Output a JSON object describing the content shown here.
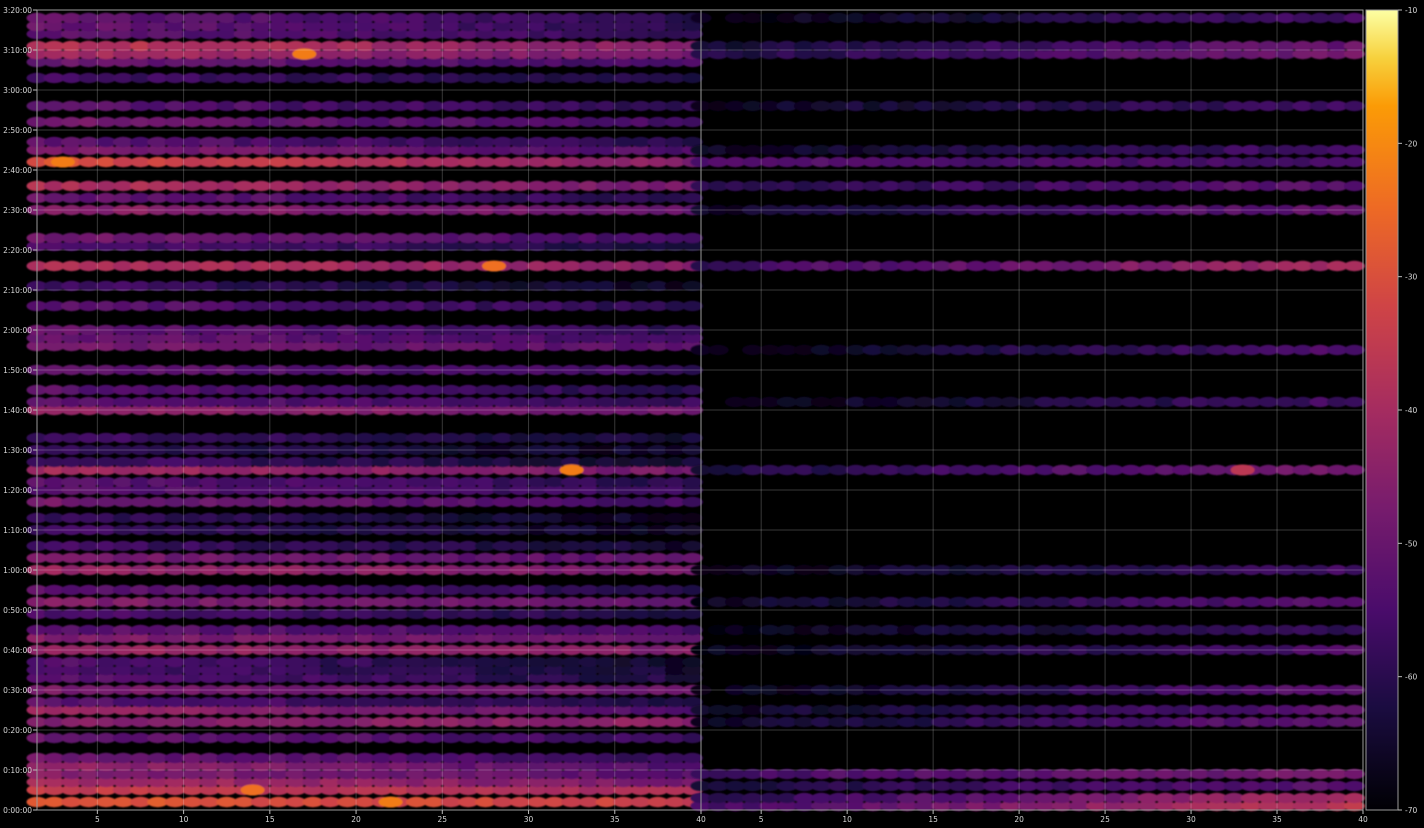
{
  "chart_data": {
    "type": "heatmap",
    "panels": [
      {
        "name": "",
        "x_ticks": [
          "5",
          "10",
          "15",
          "20",
          "25",
          "30",
          "35",
          "40"
        ],
        "x_tick_values": [
          5,
          10,
          15,
          20,
          25,
          30,
          35,
          40
        ],
        "xlim": [
          1.5,
          40
        ]
      },
      {
        "name": "",
        "x_ticks": [
          "5",
          "10",
          "15",
          "20",
          "25",
          "30",
          "35",
          "40"
        ],
        "x_tick_values": [
          5,
          10,
          15,
          20,
          25,
          30,
          35,
          40
        ],
        "xlim": [
          1.5,
          40
        ]
      }
    ],
    "y_ticks": [
      "0:00:00",
      "0:10:00",
      "0:20:00",
      "0:30:00",
      "0:40:00",
      "0:50:00",
      "1:00:00",
      "1:10:00",
      "1:20:00",
      "1:30:00",
      "1:40:00",
      "1:50:00",
      "2:00:00",
      "2:10:00",
      "2:20:00",
      "2:30:00",
      "2:40:00",
      "2:50:00",
      "3:00:00",
      "3:10:00",
      "3:20:00"
    ],
    "y_tick_minutes": [
      0,
      10,
      20,
      30,
      40,
      50,
      60,
      70,
      80,
      90,
      100,
      110,
      120,
      130,
      140,
      150,
      160,
      170,
      180,
      190,
      200
    ],
    "ylim_minutes": [
      0,
      200
    ],
    "x_range": [
      1.5,
      39.5
    ],
    "grid": true,
    "colorbar": {
      "ticks": [
        "-10",
        "-20",
        "-30",
        "-40",
        "-50",
        "-60",
        "-70"
      ],
      "tick_values": [
        -10,
        -20,
        -30,
        -40,
        -50,
        -60,
        -70
      ],
      "range": [
        -70,
        -10
      ],
      "colormap": "inferno"
    },
    "bands": [
      {
        "t": 2,
        "l": -28,
        "r": -34
      },
      {
        "t": 5,
        "l": -34,
        "r": -40
      },
      {
        "t": 7,
        "l": -40,
        "r": -47
      },
      {
        "t": 9,
        "l": -45,
        "r": -52
      },
      {
        "t": 11,
        "l": -43,
        "r": -54
      },
      {
        "t": 13,
        "l": -49,
        "r": -58
      },
      {
        "t": 18,
        "l": -50,
        "r": -58
      },
      {
        "t": 22,
        "l": -46,
        "r": -44
      },
      {
        "t": 25,
        "l": -40,
        "r": -54
      },
      {
        "t": 27,
        "l": -52,
        "r": -62
      },
      {
        "t": 30,
        "l": -47,
        "r": -50
      },
      {
        "t": 33,
        "l": -52,
        "r": -62
      },
      {
        "t": 35,
        "l": -54,
        "r": -64
      },
      {
        "t": 37,
        "l": -54,
        "r": -64
      },
      {
        "t": 40,
        "l": -42,
        "r": -46
      },
      {
        "t": 43,
        "l": -46,
        "r": -50
      },
      {
        "t": 45,
        "l": -52,
        "r": -56
      },
      {
        "t": 49,
        "l": -54,
        "r": -62
      },
      {
        "t": 52,
        "l": -46,
        "r": -50
      },
      {
        "t": 55,
        "l": -52,
        "r": -60
      },
      {
        "t": 60,
        "l": -42,
        "r": -48
      },
      {
        "t": 63,
        "l": -48,
        "r": -52
      },
      {
        "t": 66,
        "l": -56,
        "r": -64
      },
      {
        "t": 70,
        "l": -56,
        "r": -66
      },
      {
        "t": 73,
        "l": -58,
        "r": -66
      },
      {
        "t": 77,
        "l": -48,
        "r": -56
      },
      {
        "t": 80,
        "l": -52,
        "r": -58
      },
      {
        "t": 82,
        "l": -52,
        "r": -60
      },
      {
        "t": 85,
        "l": -40,
        "r": -48
      },
      {
        "t": 87,
        "l": -56,
        "r": -64
      },
      {
        "t": 90,
        "l": -58,
        "r": -66
      },
      {
        "t": 93,
        "l": -56,
        "r": -64
      },
      {
        "t": 100,
        "l": -42,
        "r": -50
      },
      {
        "t": 102,
        "l": -52,
        "r": -58
      },
      {
        "t": 105,
        "l": -52,
        "r": -60
      },
      {
        "t": 110,
        "l": -50,
        "r": -58
      },
      {
        "t": 116,
        "l": -48,
        "r": -52
      },
      {
        "t": 118,
        "l": -50,
        "r": -56
      },
      {
        "t": 120,
        "l": -50,
        "r": -60
      },
      {
        "t": 126,
        "l": -52,
        "r": -60
      },
      {
        "t": 131,
        "l": -56,
        "r": -66
      },
      {
        "t": 136,
        "l": -38,
        "r": -44
      },
      {
        "t": 141,
        "l": -54,
        "r": -62
      },
      {
        "t": 143,
        "l": -48,
        "r": -56
      },
      {
        "t": 150,
        "l": -44,
        "r": -50
      },
      {
        "t": 153,
        "l": -50,
        "r": -60
      },
      {
        "t": 156,
        "l": -38,
        "r": -48
      },
      {
        "t": 162,
        "l": -30,
        "r": -46
      },
      {
        "t": 165,
        "l": -46,
        "r": -54
      },
      {
        "t": 167,
        "l": -52,
        "r": -60
      },
      {
        "t": 172,
        "l": -48,
        "r": -56
      },
      {
        "t": 176,
        "l": -52,
        "r": -60
      },
      {
        "t": 183,
        "l": -56,
        "r": -62
      },
      {
        "t": 187,
        "l": -50,
        "r": -56
      },
      {
        "t": 189,
        "l": -40,
        "r": -48
      },
      {
        "t": 191,
        "l": -36,
        "r": -46
      },
      {
        "t": 194,
        "l": -52,
        "r": -58
      },
      {
        "t": 196,
        "l": -50,
        "r": -60
      },
      {
        "t": 198,
        "l": -50,
        "r": -60
      }
    ],
    "bands_panel2": [
      {
        "t": 1,
        "l": -56,
        "r": -36
      },
      {
        "t": 3,
        "l": -60,
        "r": -40
      },
      {
        "t": 6,
        "l": -62,
        "r": -52
      },
      {
        "t": 9,
        "l": -56,
        "r": -48
      },
      {
        "t": 22,
        "l": -66,
        "r": -50
      },
      {
        "t": 25,
        "l": -66,
        "r": -52
      },
      {
        "t": 30,
        "l": -68,
        "r": -52
      },
      {
        "t": 40,
        "l": -68,
        "r": -54
      },
      {
        "t": 45,
        "l": -68,
        "r": -58
      },
      {
        "t": 52,
        "l": -66,
        "r": -52
      },
      {
        "t": 60,
        "l": -68,
        "r": -56
      },
      {
        "t": 85,
        "l": -62,
        "r": -48
      },
      {
        "t": 102,
        "l": -68,
        "r": -56
      },
      {
        "t": 115,
        "l": -68,
        "r": -54
      },
      {
        "t": 136,
        "l": -58,
        "r": -40
      },
      {
        "t": 150,
        "l": -66,
        "r": -50
      },
      {
        "t": 156,
        "l": -60,
        "r": -52
      },
      {
        "t": 162,
        "l": -54,
        "r": -56
      },
      {
        "t": 165,
        "l": -66,
        "r": -56
      },
      {
        "t": 176,
        "l": -66,
        "r": -56
      },
      {
        "t": 189,
        "l": -62,
        "r": -48
      },
      {
        "t": 191,
        "l": -64,
        "r": -50
      },
      {
        "t": 198,
        "l": -68,
        "r": -56
      }
    ],
    "hotspots": [
      {
        "panel": 0,
        "x": 32.5,
        "t": 85,
        "value": -22
      },
      {
        "panel": 0,
        "x": 17,
        "t": 189,
        "value": -22
      },
      {
        "panel": 0,
        "x": 3,
        "t": 162,
        "value": -22
      },
      {
        "panel": 0,
        "x": 28,
        "t": 136,
        "value": -24
      },
      {
        "panel": 0,
        "x": 14,
        "t": 5,
        "value": -24
      },
      {
        "panel": 0,
        "x": 22,
        "t": 2,
        "value": -22
      },
      {
        "panel": 1,
        "x": 33,
        "t": 85,
        "value": -36
      }
    ]
  }
}
